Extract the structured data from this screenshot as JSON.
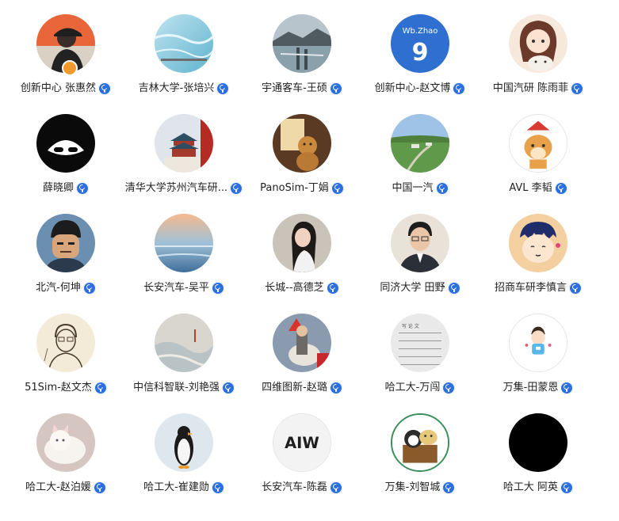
{
  "members": [
    {
      "name": "创新中心 张惠然",
      "avatar": "person-cap-avatar-orange",
      "role_badge": "admin-icon"
    },
    {
      "name": "吉林大学-张培兴",
      "avatar": "water-photo-avatar"
    },
    {
      "name": "宇通客车-王硕",
      "avatar": "harbor-photo-avatar"
    },
    {
      "name": "创新中心-赵文博",
      "avatar": "jersey-avatar",
      "avatar_text": "Wb.Zhao",
      "avatar_number": "9"
    },
    {
      "name": "中国汽研 陈雨菲",
      "avatar": "anime-girl-cat-avatar"
    },
    {
      "name": "薛晓卿",
      "avatar": "black-white-mask-avatar"
    },
    {
      "name": "清华大学苏州汽车研...",
      "avatar": "temple-photo-avatar"
    },
    {
      "name": "PanoSim-丁娟",
      "avatar": "dog-photo-avatar"
    },
    {
      "name": "中国一汽",
      "avatar": "landscape-photo-avatar"
    },
    {
      "name": "AVL 李韬",
      "avatar": "christmas-deer-avatar"
    },
    {
      "name": "北汽-何坤",
      "avatar": "anime-man-avatar"
    },
    {
      "name": "长安汽车-吴平",
      "avatar": "beach-photo-avatar"
    },
    {
      "name": "长城--高德芝",
      "avatar": "woman-photo-avatar"
    },
    {
      "name": "同济大学 田野",
      "avatar": "man-suit-avatar"
    },
    {
      "name": "招商车研李慎言",
      "avatar": "cartoon-boy-avatar"
    },
    {
      "name": "51Sim-赵文杰",
      "avatar": "sketch-portrait-avatar"
    },
    {
      "name": "中信科智联-刘艳强",
      "avatar": "painting-avatar"
    },
    {
      "name": "四维图新-赵璐",
      "avatar": "knight-horse-avatar"
    },
    {
      "name": "哈工大-万闯",
      "avatar": "calligraphy-avatar",
      "avatar_text": "写 论 文"
    },
    {
      "name": "万集-田蒙恩",
      "avatar": "cartoon-boy-white-avatar"
    },
    {
      "name": "哈工大-赵泊媛",
      "avatar": "white-cat-avatar"
    },
    {
      "name": "哈工大-崔建勋",
      "avatar": "penguin-avatar"
    },
    {
      "name": "长安汽车-陈磊",
      "avatar": "aiw-logo-avatar",
      "avatar_text": "AIW"
    },
    {
      "name": "万集-刘智城",
      "avatar": "cartoon-animals-avatar"
    },
    {
      "name": "哈工大 阿英",
      "avatar": "black-avatar"
    }
  ],
  "colors": {
    "verified_badge": "#2b6fe0",
    "admin_badge": "#f29a2e",
    "name_text": "#222222"
  }
}
